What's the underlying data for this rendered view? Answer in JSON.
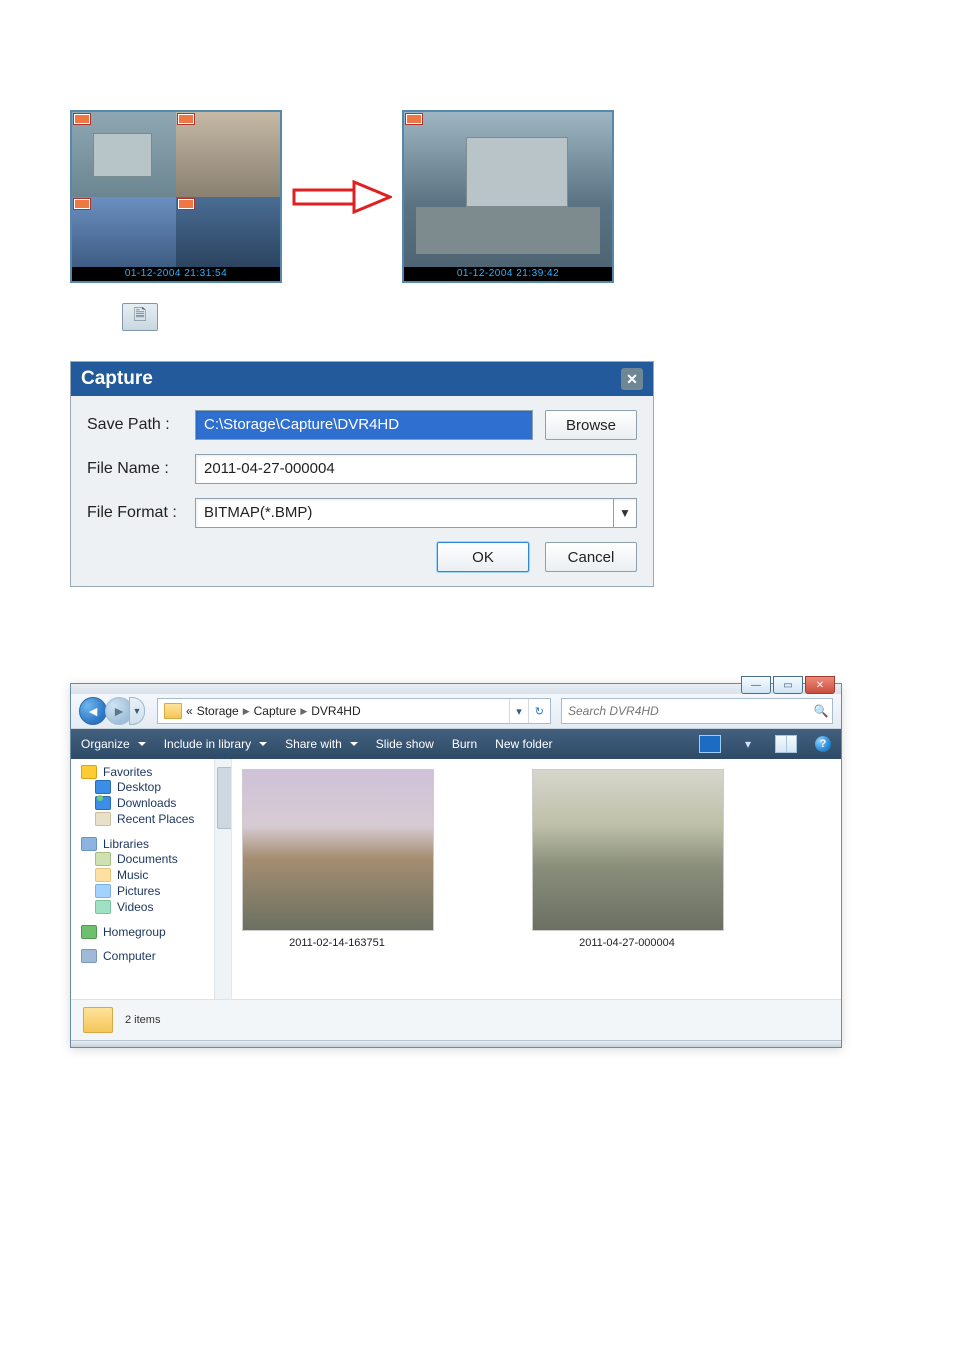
{
  "preview": {
    "quad_timestamp": "01-12-2004 21:31:54",
    "single_timestamp": "01-12-2004 21:39:42"
  },
  "capture_dialog": {
    "title": "Capture",
    "labels": {
      "save_path": "Save Path :",
      "file_name": "File Name :",
      "file_format": "File Format :"
    },
    "values": {
      "save_path": "C:\\Storage\\Capture\\DVR4HD",
      "file_name": "2011-04-27-000004",
      "file_format": "BITMAP(*.BMP)"
    },
    "buttons": {
      "browse": "Browse",
      "ok": "OK",
      "cancel": "Cancel"
    }
  },
  "explorer": {
    "breadcrumb": {
      "lead": "«",
      "parts": [
        "Storage",
        "Capture",
        "DVR4HD"
      ]
    },
    "search_placeholder": "Search DVR4HD",
    "toolbar": {
      "organize": "Organize",
      "include": "Include in library",
      "share": "Share with",
      "slideshow": "Slide show",
      "burn": "Burn",
      "newfolder": "New folder"
    },
    "nav": {
      "favorites": "Favorites",
      "desktop": "Desktop",
      "downloads": "Downloads",
      "recent": "Recent Places",
      "libraries": "Libraries",
      "documents": "Documents",
      "music": "Music",
      "pictures": "Pictures",
      "videos": "Videos",
      "homegroup": "Homegroup",
      "computer": "Computer"
    },
    "files": [
      {
        "name": "2011-02-14-163751"
      },
      {
        "name": "2011-04-27-000004"
      }
    ],
    "status": "2 items"
  }
}
